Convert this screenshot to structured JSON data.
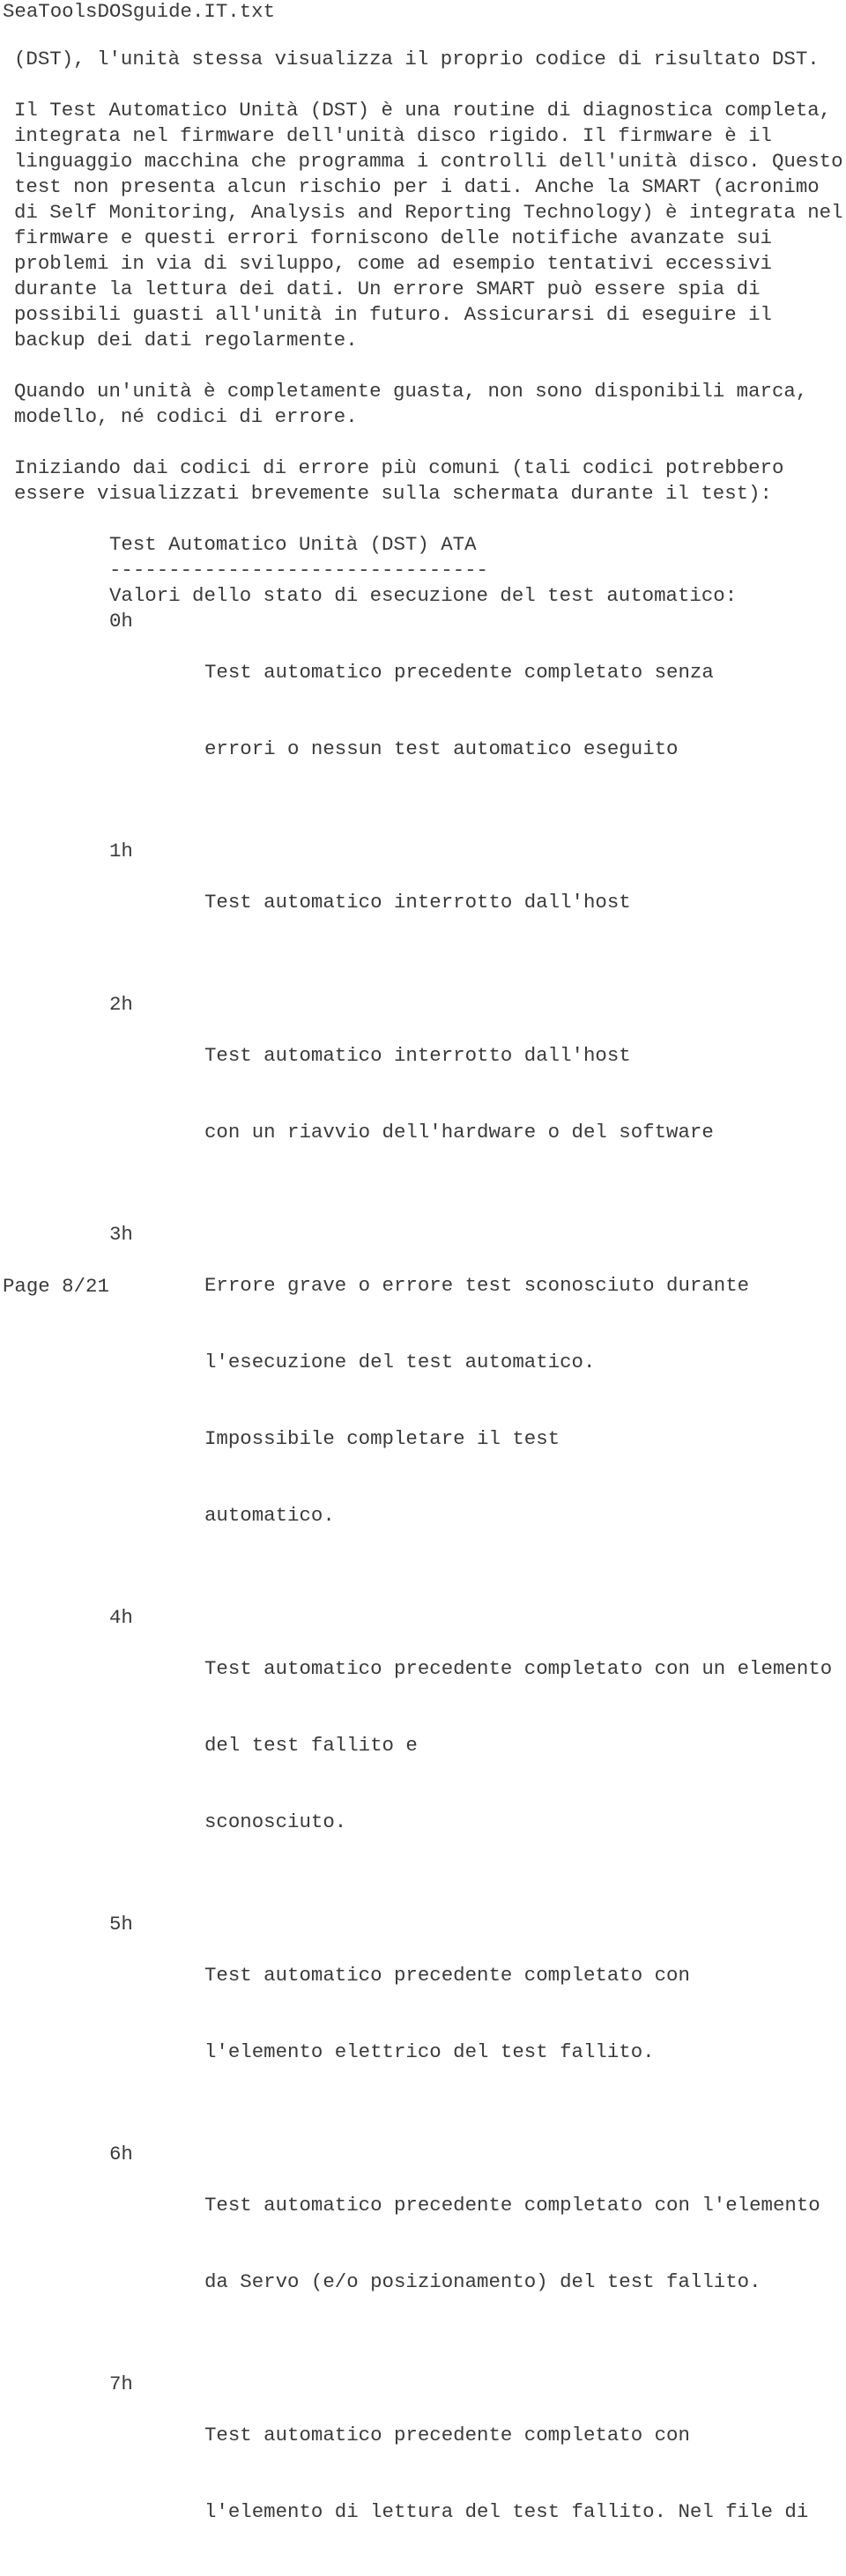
{
  "document": {
    "title": "SeaToolsDOSguide.IT.txt",
    "footer": "Page 8/21",
    "paragraphs": [
      {
        "lines": [
          "(DST), l'unità stessa visualizza il proprio codice di risultato DST."
        ]
      },
      {
        "lines": [
          "Il Test Automatico Unità (DST) è una routine di diagnostica completa,",
          "integrata nel firmware dell'unità disco rigido. Il firmware è il",
          "linguaggio macchina che programma i controlli dell'unità disco. Questo",
          "test non presenta alcun rischio per i dati. Anche la SMART (acronimo",
          "di Self Monitoring, Analysis and Reporting Technology) è integrata nel",
          "firmware e questi errori forniscono delle notifiche avanzate sui",
          "problemi in via di sviluppo, come ad esempio tentativi eccessivi",
          "durante la lettura dei dati. Un errore SMART può essere spia di",
          "possibili guasti all'unità in futuro. Assicurarsi di eseguire il",
          "backup dei dati regolarmente."
        ]
      },
      {
        "lines": [
          "Quando un'unità è completamente guasta, non sono disponibili marca,",
          "modello, né codici di errore."
        ]
      },
      {
        "lines": [
          "Iniziando dai codici di errore più comuni (tali codici potrebbero",
          "essere visualizzati brevemente sulla schermata durante il test):"
        ]
      }
    ],
    "table": {
      "title": "Test Automatico Unità (DST) ATA",
      "separator": "--------------------------------",
      "subtitle": "Valori dello stato di esecuzione del test automatico:",
      "codes": [
        {
          "code": "0h",
          "lines": [
            "Test automatico precedente completato senza",
            "errori o nessun test automatico eseguito"
          ]
        },
        {
          "code": "1h",
          "lines": [
            "Test automatico interrotto dall'host"
          ]
        },
        {
          "code": "2h",
          "lines": [
            "Test automatico interrotto dall'host",
            "con un riavvio dell'hardware o del software"
          ]
        },
        {
          "code": "3h",
          "lines": [
            "Errore grave o errore test sconosciuto durante",
            "l'esecuzione del test automatico.",
            "Impossibile completare il test",
            "automatico."
          ]
        },
        {
          "code": "4h",
          "lines": [
            "Test automatico precedente completato con un elemento",
            "del test fallito e",
            "sconosciuto."
          ]
        },
        {
          "code": "5h",
          "lines": [
            "Test automatico precedente completato con",
            "l'elemento elettrico del test fallito."
          ]
        },
        {
          "code": "6h",
          "lines": [
            "Test automatico precedente completato con l'elemento",
            "da Servo (e/o posizionamento) del test fallito."
          ]
        },
        {
          "code": "7h",
          "lines": [
            "Test automatico precedente completato con",
            "l'elemento di lettura del test fallito. Nel file di"
          ]
        }
      ]
    }
  }
}
